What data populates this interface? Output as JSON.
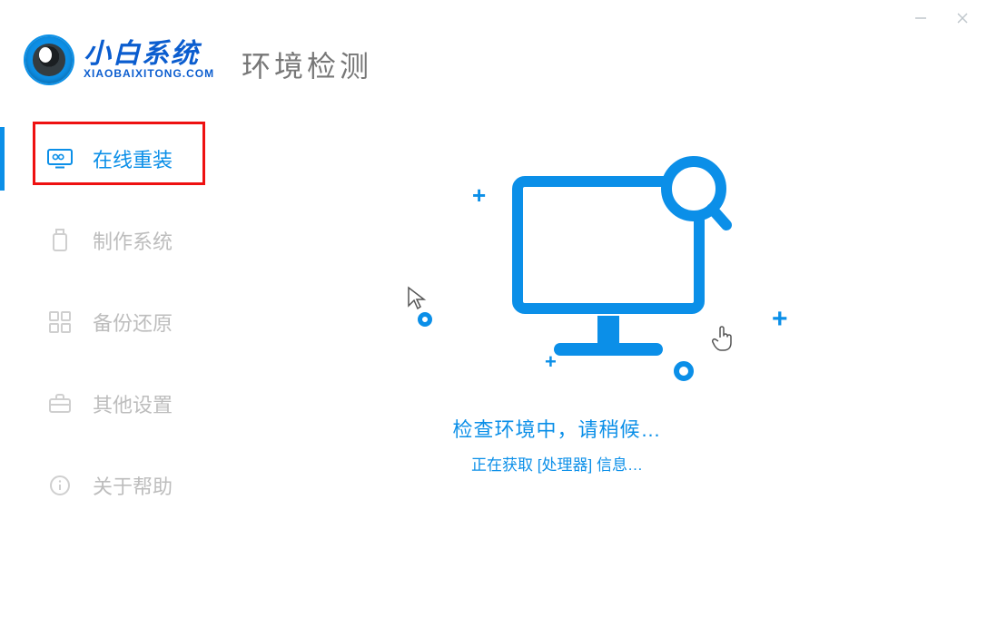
{
  "app": {
    "logo_cn": "小白系统",
    "logo_en": "XIAOBAIXITONG.COM"
  },
  "header": {
    "title": "环境检测"
  },
  "sidebar": {
    "items": [
      {
        "label": "在线重装",
        "icon": "screen-gear-icon",
        "active": true
      },
      {
        "label": "制作系统",
        "icon": "usb-icon",
        "active": false
      },
      {
        "label": "备份还原",
        "icon": "grid-icon",
        "active": false
      },
      {
        "label": "其他设置",
        "icon": "briefcase-icon",
        "active": false
      },
      {
        "label": "关于帮助",
        "icon": "info-icon",
        "active": false
      }
    ]
  },
  "status": {
    "line1": "检查环境中，请稍候…",
    "line2": "正在获取 [处理器] 信息…"
  },
  "colors": {
    "accent": "#0b8fe8",
    "highlight_border": "#e11",
    "muted": "#bdbdbd"
  }
}
